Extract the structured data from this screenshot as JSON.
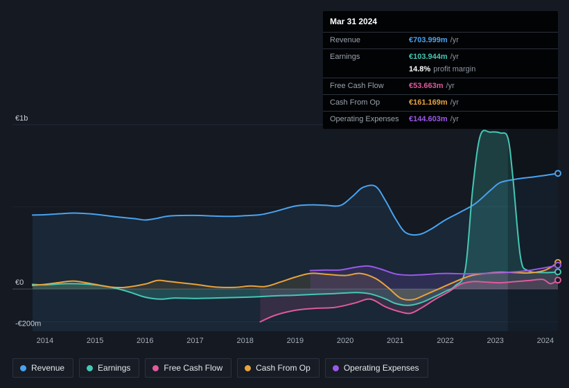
{
  "tooltip": {
    "date": "Mar 31 2024",
    "rows": [
      {
        "label": "Revenue",
        "value": "€703.999m",
        "suffix": "/yr",
        "color": "#4aa3f0",
        "divider": true
      },
      {
        "label": "Earnings",
        "value": "€103.944m",
        "suffix": "/yr",
        "color": "#45c8b5",
        "divider": true
      },
      {
        "label": "",
        "value": "14.8%",
        "suffix": "profit margin",
        "color": "#ffffff",
        "divider": false
      },
      {
        "label": "Free Cash Flow",
        "value": "€53.663m",
        "suffix": "/yr",
        "color": "#e05a9d",
        "divider": true
      },
      {
        "label": "Cash From Op",
        "value": "€161.169m",
        "suffix": "/yr",
        "color": "#e8a33d",
        "divider": true
      },
      {
        "label": "Operating Expenses",
        "value": "€144.603m",
        "suffix": "/yr",
        "color": "#9b59e8",
        "divider": true
      }
    ]
  },
  "legend": [
    {
      "label": "Revenue",
      "color": "#4aa3f0"
    },
    {
      "label": "Earnings",
      "color": "#45c8b5"
    },
    {
      "label": "Free Cash Flow",
      "color": "#e05a9d"
    },
    {
      "label": "Cash From Op",
      "color": "#e8a33d"
    },
    {
      "label": "Operating Expenses",
      "color": "#9b59e8"
    }
  ],
  "chart_data": {
    "type": "area",
    "unit": "EUR millions",
    "x_range": [
      2013.35,
      2024.25
    ],
    "y_range_m": [
      -257,
      1000
    ],
    "x_ticks": [
      2014,
      2015,
      2016,
      2017,
      2018,
      2019,
      2020,
      2021,
      2022,
      2023,
      2024
    ],
    "y_labels": [
      {
        "text": "€1b",
        "value": 1000
      },
      {
        "text": "€0",
        "value": 0
      },
      {
        "text": "-€200m",
        "value": -200
      }
    ],
    "gridlines": [
      1000,
      500,
      0,
      -200
    ],
    "highlight_band": {
      "from": 2023.25,
      "to": 2024.25
    },
    "legend_position": "bottom",
    "series": [
      {
        "name": "Revenue",
        "color": "#4aa3f0",
        "fill_opacity": 0.1,
        "fill_to": "bottom",
        "points": [
          [
            2013.75,
            450
          ],
          [
            2014,
            452
          ],
          [
            2014.3,
            458
          ],
          [
            2014.6,
            462
          ],
          [
            2015,
            455
          ],
          [
            2015.4,
            440
          ],
          [
            2015.8,
            428
          ],
          [
            2016,
            420
          ],
          [
            2016.2,
            428
          ],
          [
            2016.5,
            445
          ],
          [
            2017,
            448
          ],
          [
            2017.35,
            444
          ],
          [
            2017.7,
            442
          ],
          [
            2018,
            446
          ],
          [
            2018.3,
            452
          ],
          [
            2018.6,
            472
          ],
          [
            2019,
            505
          ],
          [
            2019.3,
            512
          ],
          [
            2019.6,
            510
          ],
          [
            2019.9,
            508
          ],
          [
            2020.15,
            565
          ],
          [
            2020.35,
            618
          ],
          [
            2020.6,
            626
          ],
          [
            2020.8,
            540
          ],
          [
            2021,
            430
          ],
          [
            2021.2,
            345
          ],
          [
            2021.45,
            330
          ],
          [
            2021.7,
            362
          ],
          [
            2022,
            420
          ],
          [
            2022.3,
            468
          ],
          [
            2022.6,
            520
          ],
          [
            2022.9,
            600
          ],
          [
            2023.1,
            648
          ],
          [
            2023.4,
            668
          ],
          [
            2023.7,
            680
          ],
          [
            2024,
            692
          ],
          [
            2024.25,
            704
          ]
        ]
      },
      {
        "name": "Earnings",
        "color": "#45c8b5",
        "fill_opacity": 0.22,
        "fill_to": "zero",
        "points": [
          [
            2013.75,
            28
          ],
          [
            2014,
            25
          ],
          [
            2014.4,
            32
          ],
          [
            2014.8,
            30
          ],
          [
            2015.1,
            22
          ],
          [
            2015.4,
            5
          ],
          [
            2015.7,
            -20
          ],
          [
            2016,
            -50
          ],
          [
            2016.3,
            -62
          ],
          [
            2016.6,
            -55
          ],
          [
            2017,
            -58
          ],
          [
            2017.4,
            -55
          ],
          [
            2017.8,
            -52
          ],
          [
            2018.2,
            -48
          ],
          [
            2018.6,
            -42
          ],
          [
            2019,
            -38
          ],
          [
            2019.4,
            -32
          ],
          [
            2019.8,
            -28
          ],
          [
            2020.2,
            -22
          ],
          [
            2020.5,
            -30
          ],
          [
            2020.8,
            -60
          ],
          [
            2021,
            -88
          ],
          [
            2021.25,
            -100
          ],
          [
            2021.5,
            -85
          ],
          [
            2021.8,
            -45
          ],
          [
            2022,
            -15
          ],
          [
            2022.2,
            20
          ],
          [
            2022.4,
            120
          ],
          [
            2022.55,
            620
          ],
          [
            2022.7,
            935
          ],
          [
            2022.9,
            955
          ],
          [
            2023.1,
            950
          ],
          [
            2023.25,
            920
          ],
          [
            2023.35,
            680
          ],
          [
            2023.5,
            200
          ],
          [
            2023.65,
            112
          ],
          [
            2024,
            100
          ],
          [
            2024.25,
            104
          ]
        ]
      },
      {
        "name": "Cash From Op",
        "color": "#e8a33d",
        "fill_opacity": 0.12,
        "fill_to": "zero",
        "points": [
          [
            2013.75,
            22
          ],
          [
            2014,
            28
          ],
          [
            2014.3,
            40
          ],
          [
            2014.6,
            48
          ],
          [
            2015,
            28
          ],
          [
            2015.3,
            12
          ],
          [
            2015.6,
            10
          ],
          [
            2016,
            30
          ],
          [
            2016.25,
            52
          ],
          [
            2016.5,
            45
          ],
          [
            2017,
            28
          ],
          [
            2017.4,
            12
          ],
          [
            2017.8,
            10
          ],
          [
            2018.1,
            18
          ],
          [
            2018.4,
            15
          ],
          [
            2018.7,
            42
          ],
          [
            2019,
            72
          ],
          [
            2019.3,
            95
          ],
          [
            2019.6,
            90
          ],
          [
            2020,
            82
          ],
          [
            2020.3,
            95
          ],
          [
            2020.6,
            65
          ],
          [
            2020.85,
            10
          ],
          [
            2021.1,
            -55
          ],
          [
            2021.35,
            -65
          ],
          [
            2021.6,
            -35
          ],
          [
            2021.9,
            5
          ],
          [
            2022.2,
            45
          ],
          [
            2022.5,
            80
          ],
          [
            2022.8,
            95
          ],
          [
            2023.1,
            102
          ],
          [
            2023.4,
            100
          ],
          [
            2023.7,
            98
          ],
          [
            2024,
            115
          ],
          [
            2024.25,
            161
          ]
        ]
      },
      {
        "name": "Operating Expenses",
        "color": "#9b59e8",
        "fill_opacity": 0.16,
        "fill_to": "zero",
        "points": [
          [
            2019.3,
            112
          ],
          [
            2019.6,
            115
          ],
          [
            2019.9,
            116
          ],
          [
            2020.2,
            132
          ],
          [
            2020.45,
            140
          ],
          [
            2020.7,
            122
          ],
          [
            2021,
            92
          ],
          [
            2021.3,
            84
          ],
          [
            2021.6,
            88
          ],
          [
            2022,
            95
          ],
          [
            2022.4,
            92
          ],
          [
            2022.8,
            95
          ],
          [
            2023.2,
            100
          ],
          [
            2023.6,
            110
          ],
          [
            2024,
            130
          ],
          [
            2024.25,
            145
          ]
        ]
      },
      {
        "name": "Free Cash Flow",
        "color": "#e05a9d",
        "fill_opacity": 0.14,
        "fill_to": "zero",
        "points": [
          [
            2018.3,
            -200
          ],
          [
            2018.6,
            -160
          ],
          [
            2019,
            -130
          ],
          [
            2019.4,
            -118
          ],
          [
            2019.8,
            -112
          ],
          [
            2020.2,
            -85
          ],
          [
            2020.5,
            -62
          ],
          [
            2020.8,
            -108
          ],
          [
            2021.05,
            -135
          ],
          [
            2021.3,
            -148
          ],
          [
            2021.55,
            -110
          ],
          [
            2021.8,
            -62
          ],
          [
            2022.05,
            -20
          ],
          [
            2022.3,
            28
          ],
          [
            2022.55,
            45
          ],
          [
            2022.8,
            42
          ],
          [
            2023.1,
            38
          ],
          [
            2023.4,
            45
          ],
          [
            2023.7,
            52
          ],
          [
            2023.95,
            58
          ],
          [
            2024.1,
            32
          ],
          [
            2024.25,
            54
          ]
        ]
      }
    ]
  }
}
